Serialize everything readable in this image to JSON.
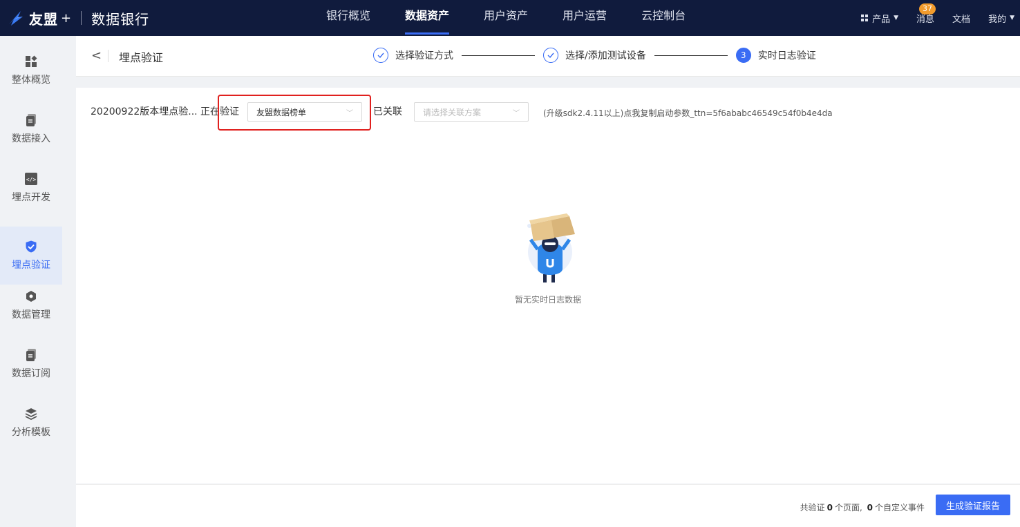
{
  "topbar": {
    "brand": "友盟",
    "plus": "+",
    "product": "数据银行",
    "nav": [
      "银行概览",
      "数据资产",
      "用户资产",
      "用户运营",
      "云控制台"
    ],
    "active_nav": "数据资产",
    "right": {
      "product_menu": "产品",
      "messages": "消息",
      "messages_badge": "37",
      "docs": "文档",
      "mine": "我的"
    }
  },
  "sidebar": {
    "items": [
      {
        "label": "整体概览",
        "icon": "dashboard-icon"
      },
      {
        "label": "数据接入",
        "icon": "document-icon"
      },
      {
        "label": "埋点开发",
        "icon": "code-icon"
      },
      {
        "label": "埋点验证",
        "icon": "shield-check-icon"
      },
      {
        "label": "数据管理",
        "icon": "hexagon-icon"
      },
      {
        "label": "数据订阅",
        "icon": "document-icon"
      },
      {
        "label": "分析模板",
        "icon": "layers-icon"
      }
    ],
    "active": "埋点验证"
  },
  "header": {
    "back": "<",
    "title": "埋点验证",
    "steps": [
      {
        "label": "选择验证方式",
        "state": "done"
      },
      {
        "label": "选择/添加测试设备",
        "state": "done"
      },
      {
        "label": "实时日志验证",
        "state": "current",
        "number": "3"
      }
    ]
  },
  "main": {
    "session_text": "20200922版本埋点验... 正在验证",
    "app_select_value": "友盟数据榜单",
    "linked_label": "已关联",
    "scheme_placeholder": "请选择关联方案",
    "hint": "(升级sdk2.4.11以上)点我复制启动参数_ttn=5f6ababc46549c54f0b4e4da",
    "empty_text": "暂无实时日志数据"
  },
  "footer": {
    "stat_prefix": "共验证",
    "pages_count": "0",
    "stat_mid": "个页面,",
    "events_count": "0",
    "stat_suffix": "个自定义事件",
    "generate_button": "生成验证报告"
  },
  "colors": {
    "topbar_bg": "#101b3d",
    "accent": "#3a6cf4",
    "highlight": "#e0201e",
    "badge": "#f29b2c"
  }
}
